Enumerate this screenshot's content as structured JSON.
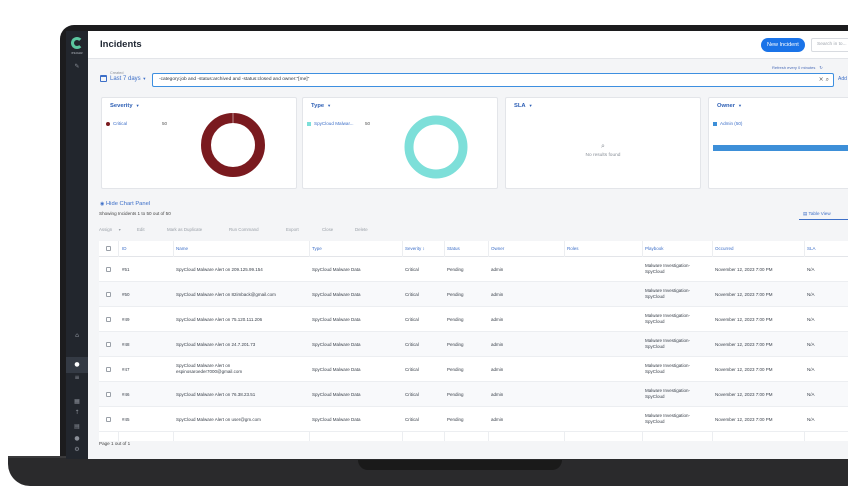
{
  "app": {
    "brand": "XSOAR",
    "page_title": "Incidents"
  },
  "header": {
    "new_incident_label": "New Incident",
    "search_placeholder": "Search in to..."
  },
  "filters": {
    "refresh_label": "Refresh every 0 minutes",
    "date_caption": "Created",
    "date_value": "Last 7 days",
    "query": "-category:job and -status:archived and -status:closed and owner:\"[me]\"",
    "add_label": "Add"
  },
  "charts": {
    "severity": {
      "title": "Severity",
      "legend_label": "Critical",
      "legend_count": "50",
      "color": "#7a1a1f",
      "fraction": 1.0
    },
    "type": {
      "title": "Type",
      "legend_label": "SpyCloud Malwar...",
      "legend_count": "50",
      "color": "#7ddfd9",
      "fraction": 1.0
    },
    "sla": {
      "title": "SLA",
      "no_results": "No results found"
    },
    "owner": {
      "title": "Owner",
      "legend_label": "Admin (50)",
      "color": "#3d8fd8"
    }
  },
  "toolbar": {
    "hide_chart_panel": "Hide Chart Panel",
    "showing": "Showing Incidents 1 to 50 out of 50",
    "table_view": "Table View",
    "actions": [
      "Assign",
      "Edit",
      "Mark as Duplicate",
      "Run Command",
      "Export",
      "Close",
      "Delete"
    ]
  },
  "table": {
    "columns": [
      "ID",
      "Name",
      "Type",
      "Severity",
      "Status",
      "Owner",
      "Roles",
      "Playbook",
      "Occurred",
      "SLA"
    ],
    "rows": [
      {
        "id": "#51",
        "name": "SpyCloud Malware Alert on 209.125.99.154",
        "type": "SpyCloud Malware Data",
        "severity": "Critical",
        "status": "Pending",
        "owner": "admin",
        "roles": "",
        "playbook": "Malware Investigation- SpyCloud",
        "occurred": "November 12, 2023 7:00 PM",
        "sla": "N/A"
      },
      {
        "id": "#50",
        "name": "SpyCloud Malware Alert on 82imback@gmail.com",
        "type": "SpyCloud Malware Data",
        "severity": "Critical",
        "status": "Pending",
        "owner": "admin",
        "roles": "",
        "playbook": "Malware Investigation- SpyCloud",
        "occurred": "November 12, 2023 7:00 PM",
        "sla": "N/A"
      },
      {
        "id": "#49",
        "name": "SpyCloud Malware Alert on 75.120.111.206",
        "type": "SpyCloud Malware Data",
        "severity": "Critical",
        "status": "Pending",
        "owner": "admin",
        "roles": "",
        "playbook": "Malware Investigation- SpyCloud",
        "occurred": "November 12, 2023 7:00 PM",
        "sla": "N/A"
      },
      {
        "id": "#48",
        "name": "SpyCloud Malware Alert on 24.7.201.73",
        "type": "SpyCloud Malware Data",
        "severity": "Critical",
        "status": "Pending",
        "owner": "admin",
        "roles": "",
        "playbook": "Malware Investigation- SpyCloud",
        "occurred": "November 12, 2023 7:00 PM",
        "sla": "N/A"
      },
      {
        "id": "#47",
        "name": "SpyCloud Malware Alert on espinosaroeder7000@gmail.com",
        "type": "SpyCloud Malware Data",
        "severity": "Critical",
        "status": "Pending",
        "owner": "admin",
        "roles": "",
        "playbook": "Malware Investigation- SpyCloud",
        "occurred": "November 12, 2023 7:00 PM",
        "sla": "N/A"
      },
      {
        "id": "#46",
        "name": "SpyCloud Malware Alert on 76.38.23.51",
        "type": "SpyCloud Malware Data",
        "severity": "Critical",
        "status": "Pending",
        "owner": "admin",
        "roles": "",
        "playbook": "Malware Investigation- SpyCloud",
        "occurred": "November 12, 2023 7:00 PM",
        "sla": "N/A"
      },
      {
        "id": "#45",
        "name": "SpyCloud Malware Alert on user@gm.com",
        "type": "SpyCloud Malware Data",
        "severity": "Critical",
        "status": "Pending",
        "owner": "admin",
        "roles": "",
        "playbook": "Malware Investigation- SpyCloud",
        "occurred": "November 12, 2023 7:00 PM",
        "sla": "N/A"
      }
    ],
    "footer": "Page 1 out of 1"
  }
}
